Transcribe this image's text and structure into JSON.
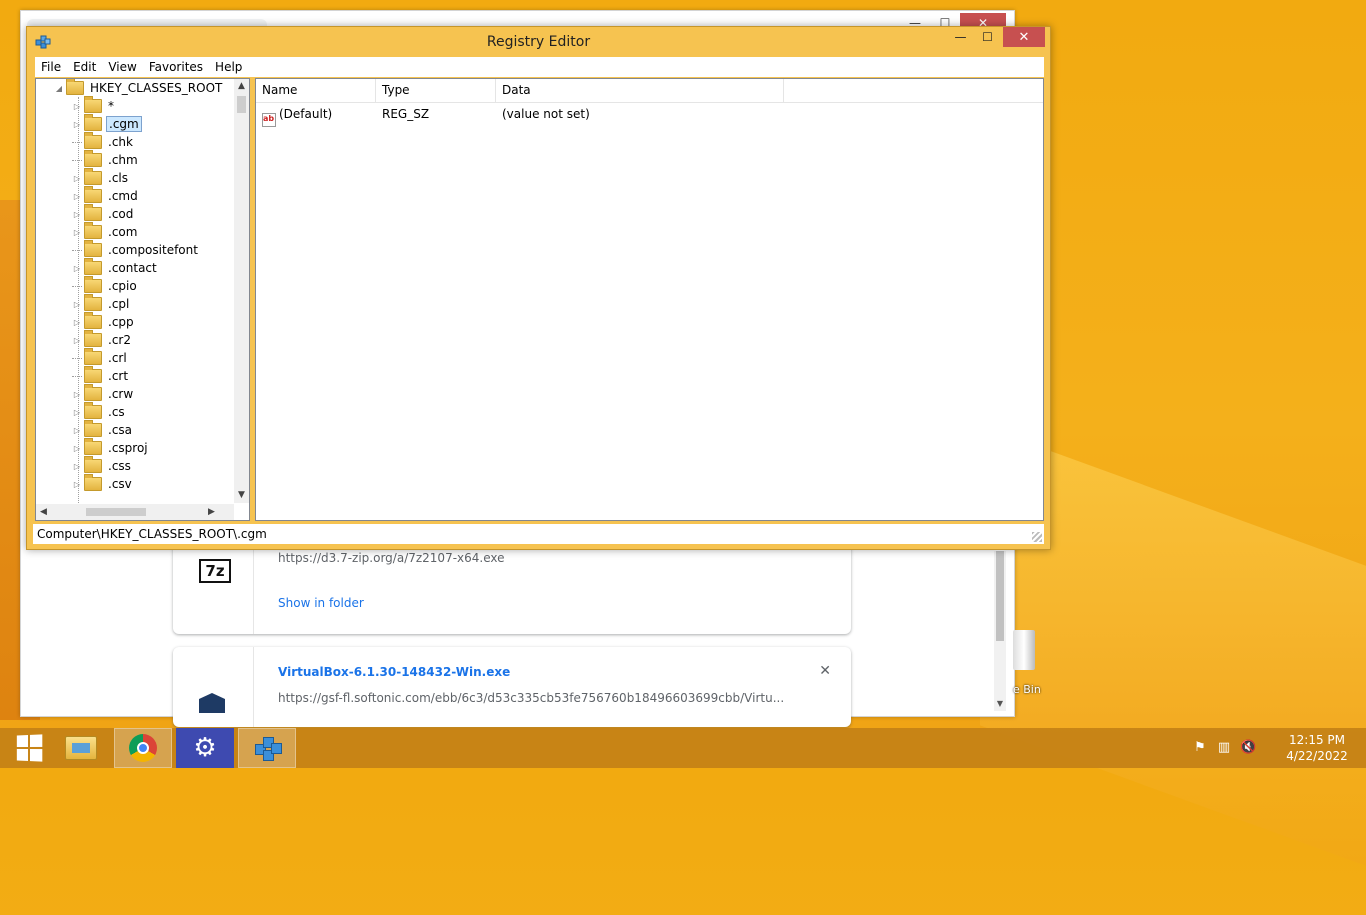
{
  "registry_editor": {
    "title": "Registry Editor",
    "window_buttons": {
      "minimize": "—",
      "maximize": "☐",
      "close": "✕"
    },
    "menu": [
      "File",
      "Edit",
      "View",
      "Favorites",
      "Help"
    ],
    "tree": {
      "root": "HKEY_CLASSES_ROOT",
      "selected": ".cgm",
      "items": [
        {
          "label": "*",
          "expandable": true
        },
        {
          "label": ".cgm",
          "expandable": true
        },
        {
          "label": ".chk",
          "expandable": false
        },
        {
          "label": ".chm",
          "expandable": false
        },
        {
          "label": ".cls",
          "expandable": true
        },
        {
          "label": ".cmd",
          "expandable": true
        },
        {
          "label": ".cod",
          "expandable": true
        },
        {
          "label": ".com",
          "expandable": true
        },
        {
          "label": ".compositefont",
          "expandable": false
        },
        {
          "label": ".contact",
          "expandable": true
        },
        {
          "label": ".cpio",
          "expandable": false
        },
        {
          "label": ".cpl",
          "expandable": true
        },
        {
          "label": ".cpp",
          "expandable": true
        },
        {
          "label": ".cr2",
          "expandable": true
        },
        {
          "label": ".crl",
          "expandable": false
        },
        {
          "label": ".crt",
          "expandable": false
        },
        {
          "label": ".crw",
          "expandable": true
        },
        {
          "label": ".cs",
          "expandable": true
        },
        {
          "label": ".csa",
          "expandable": true
        },
        {
          "label": ".csproj",
          "expandable": true
        },
        {
          "label": ".css",
          "expandable": true
        },
        {
          "label": ".csv",
          "expandable": true
        }
      ]
    },
    "columns": [
      "Name",
      "Type",
      "Data"
    ],
    "values": [
      {
        "name": "(Default)",
        "type": "REG_SZ",
        "data": "(value not set)",
        "icon": "ab"
      }
    ],
    "status_path": "Computer\\HKEY_CLASSES_ROOT\\.cgm"
  },
  "chrome_downloads": {
    "items": [
      {
        "url": "https://d3.7-zip.org/a/7z2107-x64.exe",
        "action": "Show in folder",
        "icon": "7z"
      },
      {
        "title": "VirtualBox-6.1.30-148432-Win.exe",
        "url": "https://gsf-fl.softonic.com/ebb/6c3/d53c335cb53fe756760b18496603699cbb/Virtu...",
        "close": "✕"
      }
    ]
  },
  "desktop": {
    "recycle_bin_label": "e Bin"
  },
  "taskbar": {
    "clock_time": "12:15 PM",
    "clock_date": "4/22/2022",
    "settings_glyph": "⚙"
  },
  "colors": {
    "accent": "#f6c350",
    "close_red": "#c75050",
    "link_blue": "#1a73e8"
  }
}
